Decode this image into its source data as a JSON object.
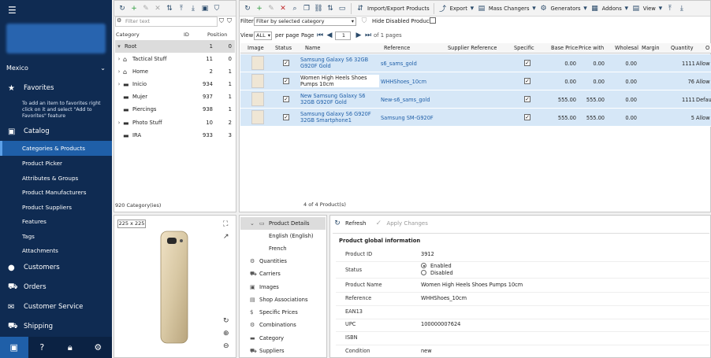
{
  "sidebar": {
    "region": "Mexico",
    "favorites_label": "Favorites",
    "favorites_hint": "To add an item to favorites right click on it and select \"Add to Favorites\" feature",
    "catalog_label": "Catalog",
    "catalog_items": [
      {
        "label": "Categories & Products"
      },
      {
        "label": "Product Picker"
      },
      {
        "label": "Attributes & Groups"
      },
      {
        "label": "Product Manufacturers"
      },
      {
        "label": "Product Suppliers"
      },
      {
        "label": "Features"
      },
      {
        "label": "Tags"
      },
      {
        "label": "Attachments"
      }
    ],
    "customers_label": "Customers",
    "orders_label": "Orders",
    "customer_service_label": "Customer Service",
    "shipping_label": "Shipping"
  },
  "category_panel": {
    "filter_placeholder": "Filter text",
    "headers": {
      "category": "Category",
      "id": "ID",
      "position": "Position"
    },
    "rows": [
      {
        "name": "Root",
        "id": "1",
        "position": "0"
      },
      {
        "name": "Tactical Stuff",
        "id": "11",
        "position": "0"
      },
      {
        "name": "Home",
        "id": "2",
        "position": "1"
      },
      {
        "name": "Inicio",
        "id": "934",
        "position": "1"
      },
      {
        "name": "Mujer",
        "id": "937",
        "position": "1"
      },
      {
        "name": "Piercings",
        "id": "938",
        "position": "1"
      },
      {
        "name": "Photo Stuff",
        "id": "10",
        "position": "2"
      },
      {
        "name": "IRA",
        "id": "933",
        "position": "3"
      }
    ],
    "count_text": "920 Category(ies)"
  },
  "preview": {
    "size_label": "225 x 225"
  },
  "grid": {
    "toolbar": {
      "import_export": "Import/Export Products",
      "export": "Export",
      "mass_changers": "Mass Changers",
      "generators": "Generators",
      "addons": "Addons",
      "view": "View"
    },
    "filter_label": "Filter",
    "filter_value": "Filter by selected category",
    "hide_disabled": "Hide Disabled Products",
    "view_label": "View",
    "view_value": "ALL",
    "per_page": "per page",
    "page_label": "Page",
    "page_value": "1",
    "of_pages": "of 1 pages",
    "headers": [
      "Image",
      "Status",
      "Name",
      "Reference",
      "Supplier Reference",
      "Specific",
      "Base Price",
      "Price with",
      "Wholesal",
      "Margin",
      "Quantity",
      "O"
    ],
    "rows": [
      {
        "name": "Samsung Galaxy S6 32GB G920F Gold",
        "reference": "s6_sams_gold",
        "base_price": "0.00",
        "price_with": "0.00",
        "wholesale": "0.00",
        "quantity": "1111",
        "extra": "Allow"
      },
      {
        "name": "Women High Heels Shoes Pumps 10cm",
        "reference": "WHHShoes_10cm",
        "base_price": "0.00",
        "price_with": "0.00",
        "wholesale": "0.00",
        "quantity": "76",
        "extra": "Allow"
      },
      {
        "name": "New Samsung Galaxy S6 32GB G920F Gold",
        "reference": "New-s6_sams_gold",
        "base_price": "555.00",
        "price_with": "555.00",
        "wholesale": "0.00",
        "quantity": "1111",
        "extra": "Default"
      },
      {
        "name": "Samsung Galaxy S6 G920F 32GB Smartphone1",
        "reference": "Samsung SM-G920F",
        "base_price": "555.00",
        "price_with": "555.00",
        "wholesale": "0.00",
        "quantity": "5",
        "extra": "Allow"
      }
    ],
    "count_text": "4 of 4 Product(s)"
  },
  "details_nav": {
    "items": [
      {
        "label": "Product Details"
      },
      {
        "label": "English (English)"
      },
      {
        "label": "French"
      },
      {
        "label": "Quantities"
      },
      {
        "label": "Carriers"
      },
      {
        "label": "Images"
      },
      {
        "label": "Shop Associations"
      },
      {
        "label": "Specific Prices"
      },
      {
        "label": "Combinations"
      },
      {
        "label": "Category"
      },
      {
        "label": "Suppliers"
      }
    ]
  },
  "details": {
    "refresh": "Refresh",
    "apply": "Apply Changes",
    "section_title": "Product global information",
    "fields": {
      "product_id": {
        "label": "Product ID",
        "value": "3912"
      },
      "status": {
        "label": "Status",
        "enabled": "Enabled",
        "disabled": "Disabled"
      },
      "product_name": {
        "label": "Product Name",
        "value": "Women High Heels Shoes Pumps 10cm"
      },
      "reference": {
        "label": "Reference",
        "value": "WHHShoes_10cm"
      },
      "ean13": {
        "label": "EAN13",
        "value": ""
      },
      "upc": {
        "label": "UPC",
        "value": "100000007624"
      },
      "isbn": {
        "label": "ISBN",
        "value": ""
      },
      "condition": {
        "label": "Condition",
        "value": "new"
      }
    }
  }
}
